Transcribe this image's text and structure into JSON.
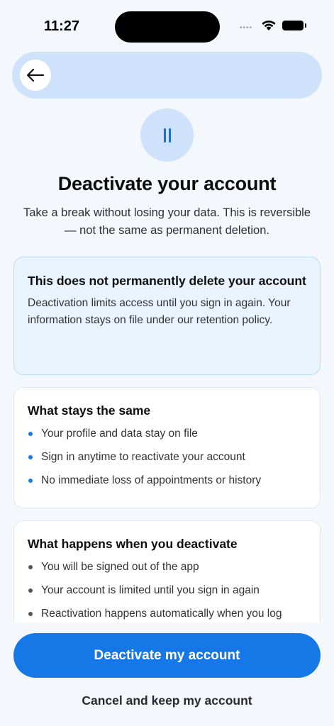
{
  "status_bar": {
    "time": "11:27",
    "signal_dots": "••••",
    "wifi_icon": "wifi-icon",
    "battery_icon": "battery-icon"
  },
  "header": {
    "back_icon": "arrow-left-icon"
  },
  "hero": {
    "icon": "pause-icon",
    "title": "Deactivate your account",
    "subtitle": "Take a break without losing your data. This is reversible — not the same as permanent deletion."
  },
  "notice_card": {
    "title": "This does not permanently delete your account",
    "body": "Deactivation limits access until you sign in again. Your information stays on file under our retention policy."
  },
  "stays_card": {
    "title": "What stays the same",
    "items": [
      "Your profile and data stay on file",
      "Sign in anytime to reactivate your account",
      "No immediate loss of appointments or history"
    ]
  },
  "happens_card": {
    "title": "What happens when you deactivate",
    "items": [
      "You will be signed out of the app",
      "Your account is limited until you sign in again",
      "Reactivation happens automatically when you log"
    ]
  },
  "actions": {
    "primary_label": "Deactivate my account",
    "secondary_label": "Cancel and keep my account"
  },
  "colors": {
    "accent": "#1677e6",
    "header_bg": "#cfe2fb",
    "notice_bg": "#e9f3fd",
    "page_bg": "#f4f7fb"
  }
}
